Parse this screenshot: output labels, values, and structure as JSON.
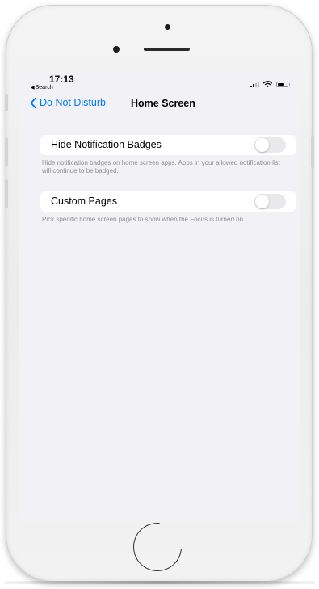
{
  "status_bar": {
    "time": "17:13",
    "back_app": "Search",
    "back_app_glyph": "◀"
  },
  "nav": {
    "back_label": "Do Not Disturb",
    "title": "Home Screen"
  },
  "settings": [
    {
      "label": "Hide Notification Badges",
      "enabled": false,
      "footnote": "Hide notification badges on home screen apps. Apps in your allowed notification list will continue to be badged."
    },
    {
      "label": "Custom Pages",
      "enabled": false,
      "footnote": "Pick specific home screen pages to show when the Focus is turned on."
    }
  ],
  "colors": {
    "accent": "#007aff",
    "screen_bg": "#f2f2f6",
    "footnote_text": "#8e8e93",
    "toggle_off": "#e9e9eb"
  },
  "icons": {
    "back": "chevron-left-icon",
    "signal": "cellular-signal-icon",
    "wifi": "wifi-icon",
    "battery": "battery-icon"
  }
}
